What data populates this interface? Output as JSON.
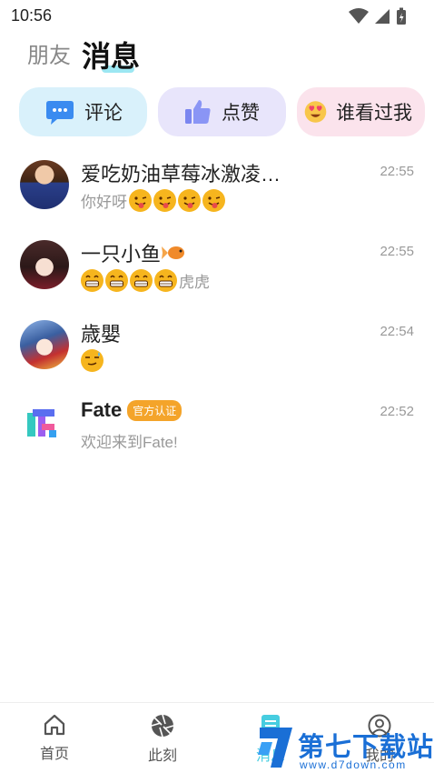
{
  "status_bar": {
    "time": "10:56"
  },
  "header": {
    "tab_friends": "朋友",
    "tab_messages": "消息"
  },
  "quick_actions": [
    {
      "label": "评论",
      "icon": "comment-bubble-icon",
      "color": "#d9f1fb"
    },
    {
      "label": "点赞",
      "icon": "thumbs-up-icon",
      "color": "#e8e5fb"
    },
    {
      "label": "谁看过我",
      "icon": "heart-eyes-emoji-icon",
      "color": "#fbe3ec"
    }
  ],
  "messages": [
    {
      "name": "爱吃奶油草莓冰激凌…",
      "preview": "你好呀",
      "time": "22:55"
    },
    {
      "name": "一只小鱼",
      "preview": "虎虎",
      "time": "22:55"
    },
    {
      "name": "歳嬰",
      "preview": "",
      "time": "22:54"
    },
    {
      "name": "Fate",
      "badge": "官方认证",
      "preview": "欢迎来到Fate!",
      "time": "22:52"
    }
  ],
  "bottom_nav": [
    {
      "label": "首页",
      "icon": "home-icon"
    },
    {
      "label": "此刻",
      "icon": "aperture-icon"
    },
    {
      "label": "消息",
      "icon": "message-doc-icon"
    },
    {
      "label": "我的",
      "icon": "profile-icon"
    }
  ],
  "watermark": {
    "title": "第七下载站",
    "url": "www.d7down.com"
  },
  "colors": {
    "accent": "#4bd3e8",
    "badge": "#f4a42a",
    "watermark_blue": "#1a6fd6"
  }
}
